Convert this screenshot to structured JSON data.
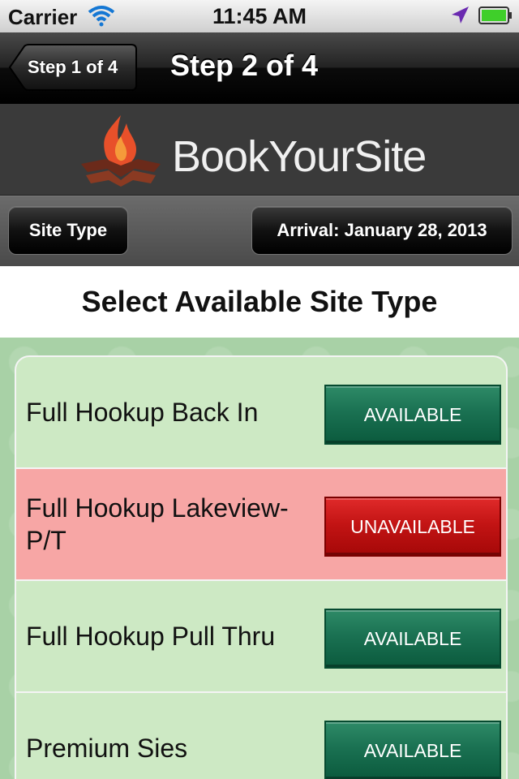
{
  "status_bar": {
    "carrier": "Carrier",
    "time": "11:45 AM",
    "icons": [
      "wifi-icon",
      "location-arrow-icon",
      "battery-icon"
    ]
  },
  "nav": {
    "back_label": "Step 1 of 4",
    "title": "Step 2 of 4"
  },
  "logo": {
    "text": "BookYourSite",
    "icon": "campfire-icon",
    "accent": "#e8502a"
  },
  "filters": {
    "site_type_label": "Site Type",
    "arrival_label": "Arrival: January 28, 2013"
  },
  "heading": "Select Available Site Type",
  "site_types": [
    {
      "name": "Full Hookup Back In",
      "status": "AVAILABLE"
    },
    {
      "name": "Full Hookup Lakeview-P/T",
      "status": "UNAVAILABLE"
    },
    {
      "name": "Full Hookup Pull Thru",
      "status": "AVAILABLE"
    },
    {
      "name": "Premium Sies",
      "status": "AVAILABLE"
    }
  ],
  "colors": {
    "available_row": "#cde9c4",
    "unavailable_row": "#f7a6a5",
    "available_button": "#1a7152",
    "unavailable_button": "#c31414"
  }
}
